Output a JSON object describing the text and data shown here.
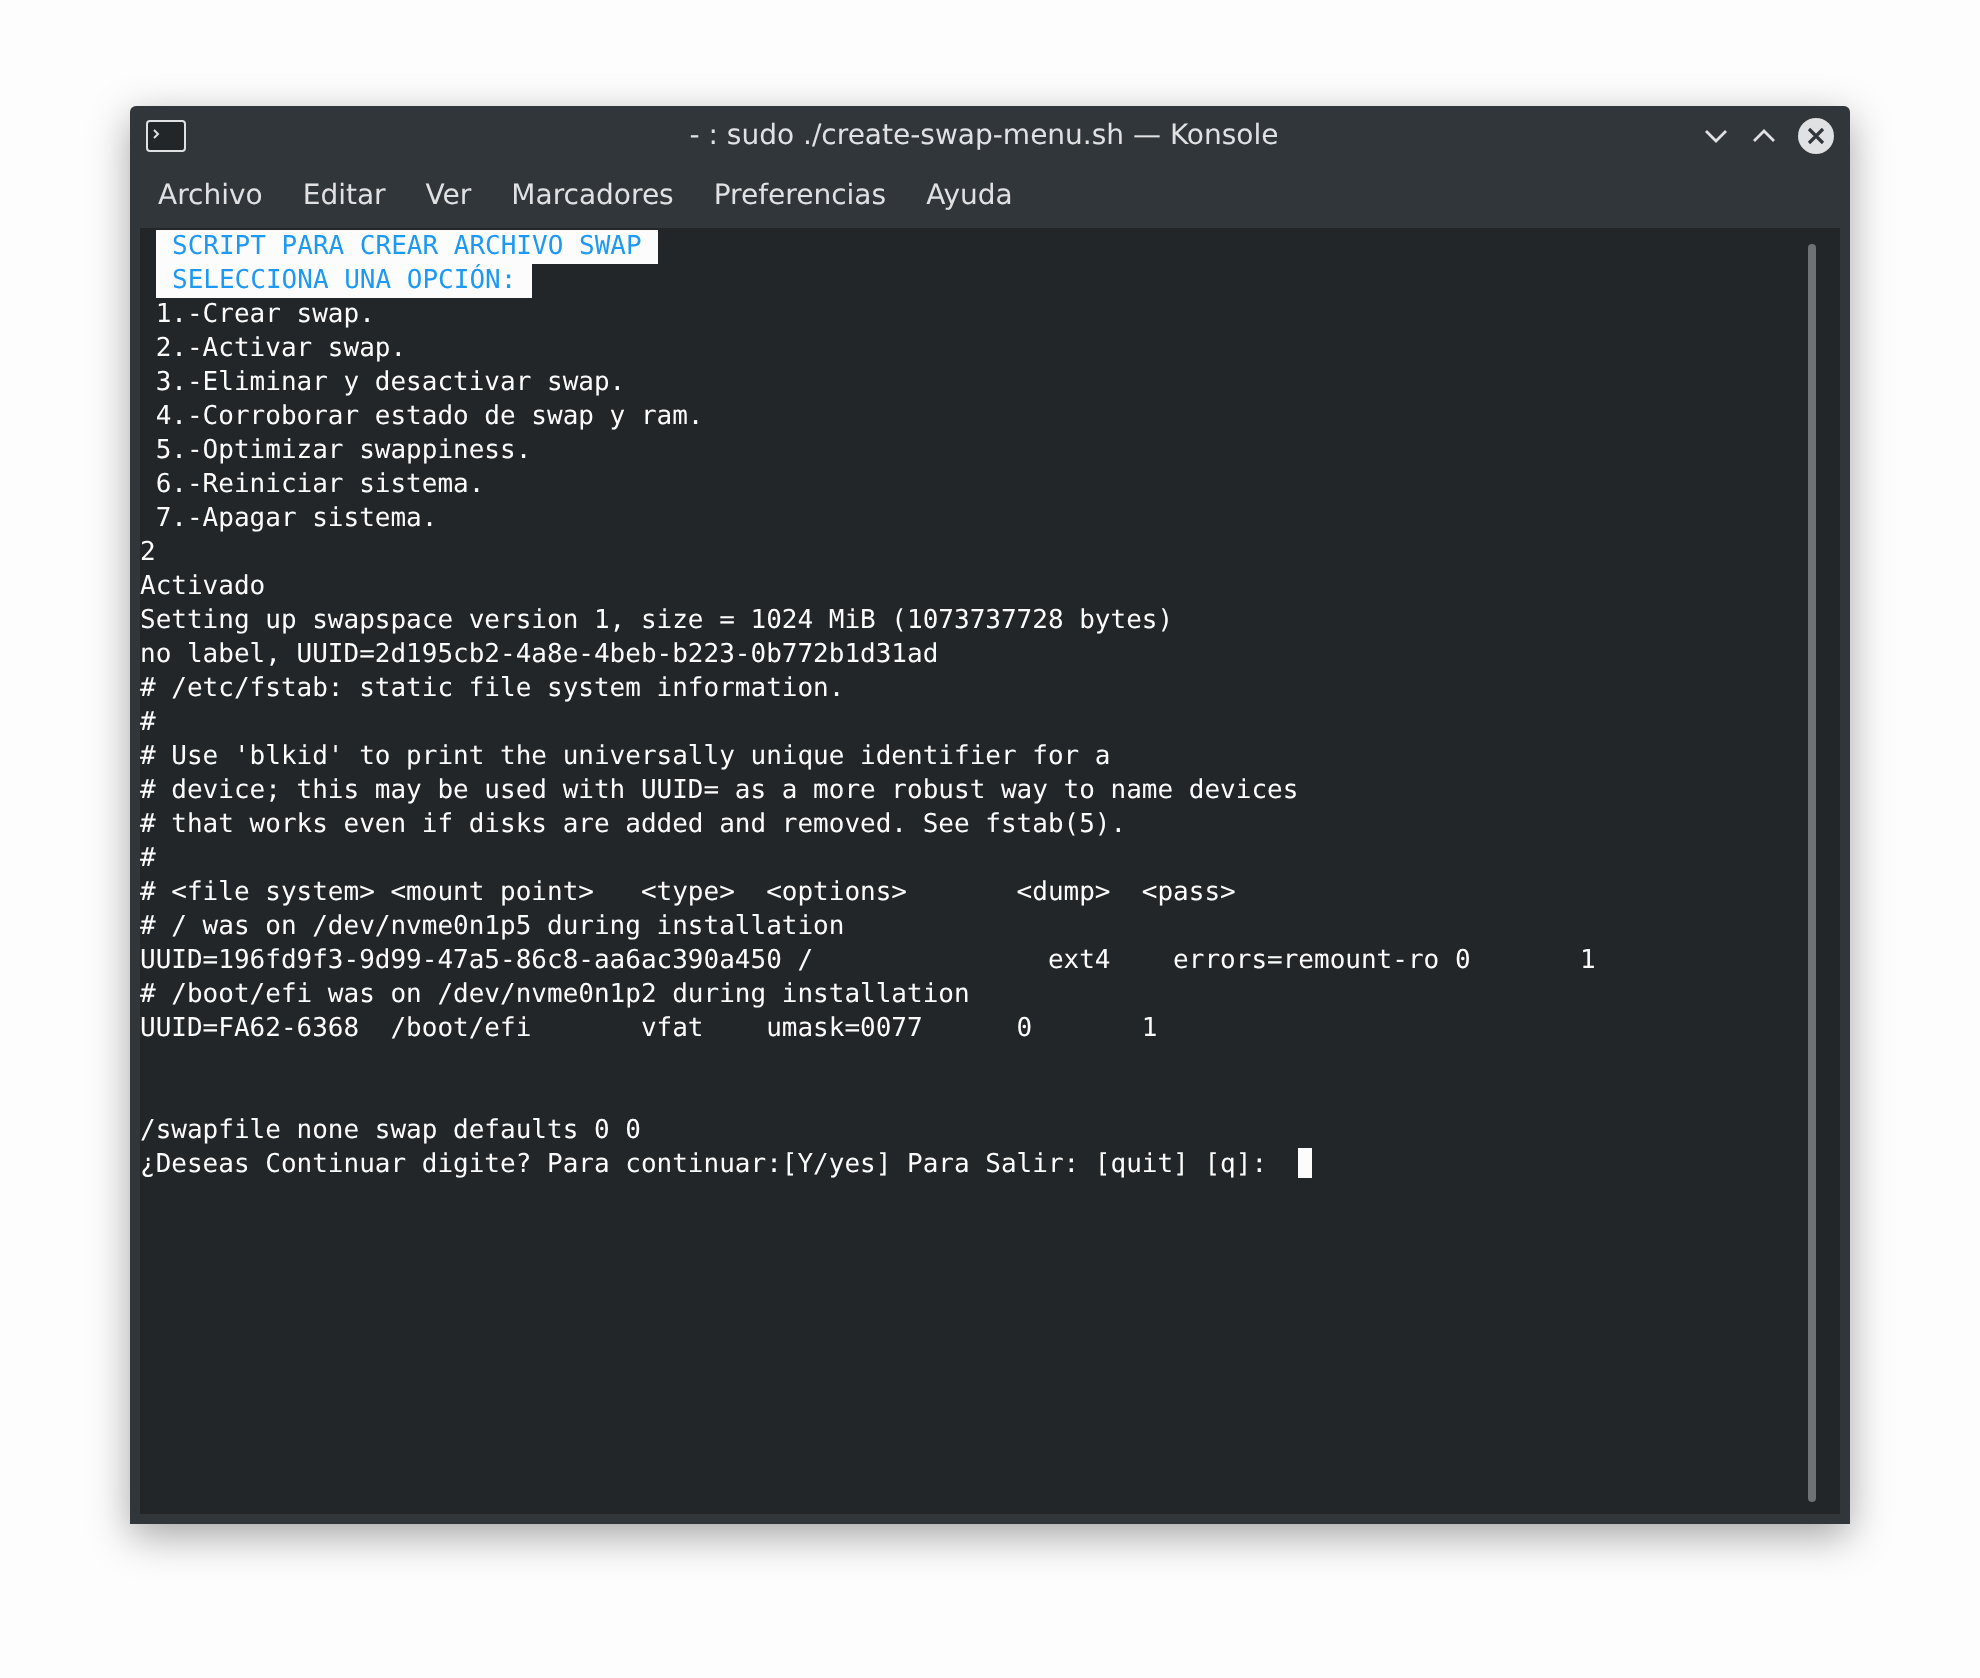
{
  "window": {
    "title": "- : sudo ./create-swap-menu.sh — Konsole"
  },
  "menu": [
    "Archivo",
    "Editar",
    "Ver",
    "Marcadores",
    "Preferencias",
    "Ayuda"
  ],
  "terminal": {
    "lines": [
      {
        "kind": "highlight",
        "text": "SCRIPT PARA CREAR ARCHIVO SWAP"
      },
      {
        "kind": "highlight",
        "text": "SELECCIONA UNA OPCIÓN:"
      },
      {
        "kind": "plain",
        "text": " 1.-Crear swap."
      },
      {
        "kind": "plain",
        "text": " 2.-Activar swap."
      },
      {
        "kind": "plain",
        "text": " 3.-Eliminar y desactivar swap."
      },
      {
        "kind": "plain",
        "text": " 4.-Corroborar estado de swap y ram."
      },
      {
        "kind": "plain",
        "text": " 5.-Optimizar swappiness."
      },
      {
        "kind": "plain",
        "text": " 6.-Reiniciar sistema."
      },
      {
        "kind": "plain",
        "text": " 7.-Apagar sistema."
      },
      {
        "kind": "plain",
        "text": "2"
      },
      {
        "kind": "plain",
        "text": "Activado"
      },
      {
        "kind": "plain",
        "text": "Setting up swapspace version 1, size = 1024 MiB (1073737728 bytes)"
      },
      {
        "kind": "plain",
        "text": "no label, UUID=2d195cb2-4a8e-4beb-b223-0b772b1d31ad"
      },
      {
        "kind": "plain",
        "text": "# /etc/fstab: static file system information."
      },
      {
        "kind": "plain",
        "text": "#"
      },
      {
        "kind": "plain",
        "text": "# Use 'blkid' to print the universally unique identifier for a"
      },
      {
        "kind": "plain",
        "text": "# device; this may be used with UUID= as a more robust way to name devices"
      },
      {
        "kind": "plain",
        "text": "# that works even if disks are added and removed. See fstab(5)."
      },
      {
        "kind": "plain",
        "text": "#"
      },
      {
        "kind": "plain",
        "text": "# <file system> <mount point>   <type>  <options>       <dump>  <pass>"
      },
      {
        "kind": "plain",
        "text": "# / was on /dev/nvme0n1p5 during installation"
      },
      {
        "kind": "plain",
        "text": "UUID=196fd9f3-9d99-47a5-86c8-aa6ac390a450 /               ext4    errors=remount-ro 0       1"
      },
      {
        "kind": "plain",
        "text": "# /boot/efi was on /dev/nvme0n1p2 during installation"
      },
      {
        "kind": "plain",
        "text": "UUID=FA62-6368  /boot/efi       vfat    umask=0077      0       1"
      },
      {
        "kind": "blank"
      },
      {
        "kind": "blank"
      },
      {
        "kind": "plain",
        "text": "/swapfile none swap defaults 0 0"
      },
      {
        "kind": "prompt",
        "text": "¿Deseas Continuar digite? Para continuar:[Y/yes] Para Salir: [quit] [q]:  ",
        "cursor": true
      }
    ]
  }
}
